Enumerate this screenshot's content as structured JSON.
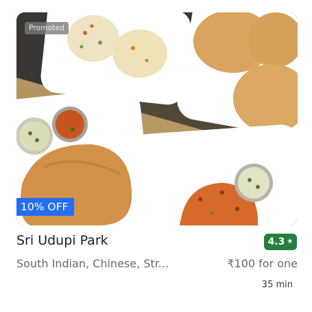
{
  "restaurant": {
    "promoted_label": "Promoted",
    "offer_label": "10% OFF",
    "name": "Sri Udupi Park",
    "rating": "4.3",
    "rating_icon": "star-icon",
    "cuisines": "South Indian, Chinese, Str...",
    "price": "₹100 for one",
    "delivery_time": "35 min",
    "colors": {
      "rating_bg": "#267e3e",
      "offer_bg": "#256fef",
      "promoted_bg": "#787878"
    }
  }
}
